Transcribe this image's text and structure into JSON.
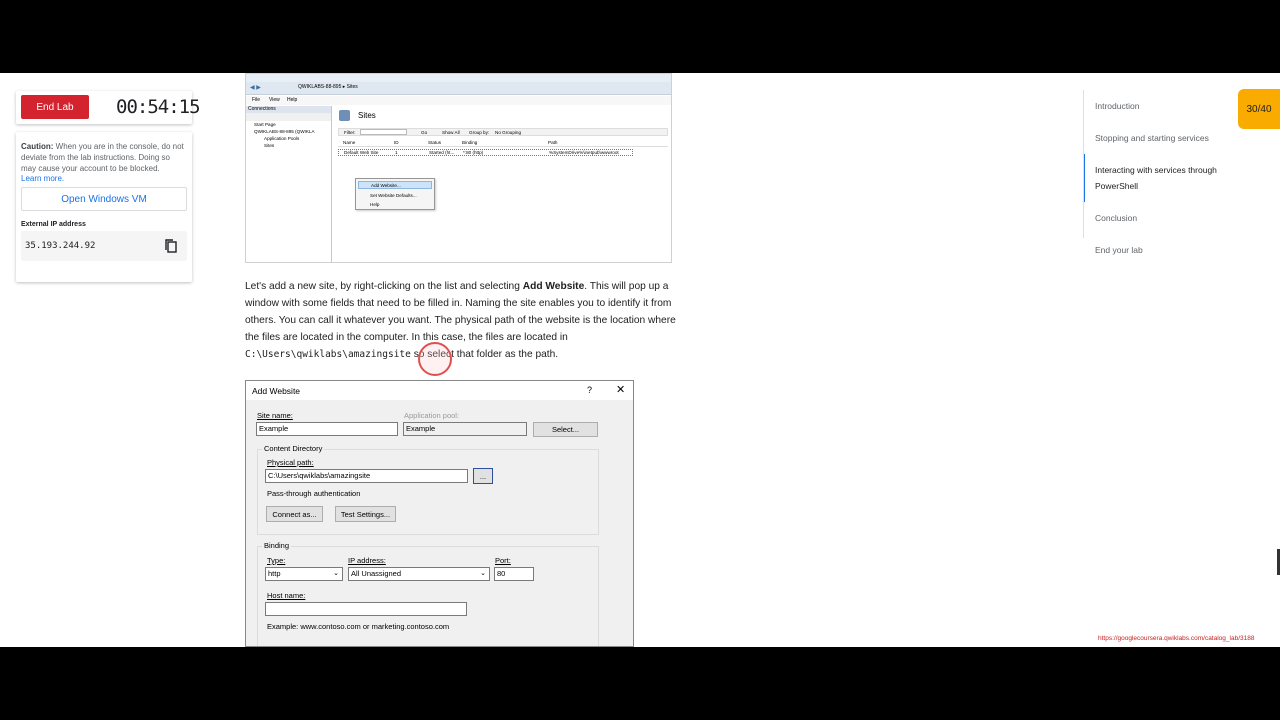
{
  "lab": {
    "end_label": "End Lab",
    "timer": "00:54:15",
    "caution_title": "Caution:",
    "caution_text": " When you are in the console, do not deviate from the lab instructions. Doing so may cause your account to be blocked.",
    "learn_more": "Learn more.",
    "open_vm": "Open Windows VM",
    "ip_label": "External IP address",
    "ip_value": "35.193.244.92"
  },
  "iis": {
    "address": "QWIKLABS-88-895  ▸  Sites",
    "menu": [
      "File",
      "View",
      "Help"
    ],
    "connections": "Connections",
    "tree": [
      "Start Page",
      "QWIKLABS-88-895 (QWIKLA",
      "Application Pools",
      "Sites"
    ],
    "sites_title": "Sites",
    "filter_label": "Filter:",
    "go": "Go",
    "show_all": "Show All",
    "group_by": "Group by:",
    "no_grouping": "No Grouping",
    "columns": [
      "Name",
      "ID",
      "Status",
      "Binding",
      "Path"
    ],
    "row": [
      "Default Web Site",
      "1",
      "Started (ht...",
      "*:80 (http)",
      "%SystemDrive%\\inetpub\\wwwroot"
    ],
    "context_menu": [
      "Add Website...",
      "Set Website Defaults...",
      "Help"
    ]
  },
  "paragraph": {
    "p1": "Let's add a new site, by right-clicking on the list and selecting ",
    "bold": "Add Website",
    "p2": ". This will pop up a window with some fields that need to be filled in. Naming the site enables you to identify it from others. You can call it whatever you want. The physical path of the website is the location where the files are located in the computer. In this case, the files are located in ",
    "code": "C:\\Users\\qwiklabs\\amazingsite",
    "p3": " so select that folder as the path."
  },
  "dialog": {
    "title": "Add Website",
    "help": "?",
    "close": "✕",
    "site_name_label": "Site name:",
    "site_name_value": "Example",
    "app_pool_label": "Application pool:",
    "app_pool_value": "Example",
    "select_btn": "Select...",
    "content_dir": "Content Directory",
    "physical_path_label": "Physical path:",
    "physical_path_value": "C:\\Users\\qwiklabs\\amazingsite",
    "browse_btn": "...",
    "passthrough": "Pass-through authentication",
    "connect_as": "Connect as...",
    "test_settings": "Test Settings...",
    "binding": "Binding",
    "type_label": "Type:",
    "type_value": "http",
    "ip_label": "IP address:",
    "ip_value": "All Unassigned",
    "port_label": "Port:",
    "port_value": "80",
    "host_label": "Host name:",
    "host_value": "",
    "example": "Example: www.contoso.com or marketing.contoso.com"
  },
  "toc": {
    "items": [
      "Introduction",
      "Stopping and starting services",
      "Interacting with services through PowerShell",
      "Conclusion",
      "End your lab"
    ],
    "active_index": 2
  },
  "progress": "30/40",
  "url": "https://googlecoursera.qwiklabs.com/catalog_lab/3188",
  "colors": {
    "end_lab": "#d3232f",
    "accent": "#1a73e8",
    "progress": "#f9ab00"
  }
}
